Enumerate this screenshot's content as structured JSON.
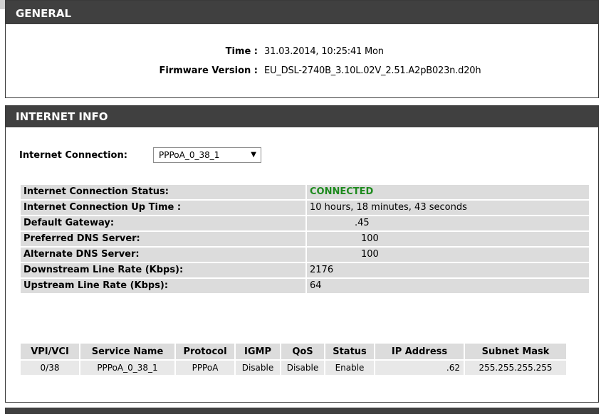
{
  "general": {
    "title": "GENERAL",
    "time_label": "Time :",
    "time_value": "31.03.2014, 10:25:41 Mon",
    "firmware_label": "Firmware Version :",
    "firmware_value": "EU_DSL-2740B_3.10L.02V_2.51.A2pB023n.d20h"
  },
  "internet_info": {
    "title": "INTERNET INFO",
    "connection_label": "Internet Connection:",
    "connection_selected": "PPPoA_0_38_1",
    "rows": [
      {
        "label": "Internet Connection Status:",
        "value": "CONNECTED"
      },
      {
        "label": "Internet Connection Up Time :",
        "value": "10 hours, 18 minutes, 43 seconds"
      },
      {
        "label": "Default Gateway:",
        "value": ".45"
      },
      {
        "label": "Preferred DNS Server:",
        "value": "100"
      },
      {
        "label": "Alternate DNS Server:",
        "value": "100"
      },
      {
        "label": "Downstream Line Rate (Kbps):",
        "value": "2176"
      },
      {
        "label": "Upstream Line Rate (Kbps):",
        "value": "64"
      }
    ],
    "table": {
      "headers": [
        "VPI/VCI",
        "Service Name",
        "Protocol",
        "IGMP",
        "QoS",
        "Status",
        "IP Address",
        "Subnet Mask"
      ],
      "row": [
        "0/38",
        "PPPoA_0_38_1",
        "PPPoA",
        "Disable",
        "Disable",
        "Enable",
        ".62",
        "255.255.255.255"
      ]
    }
  },
  "colors": {
    "header_bg": "#404040",
    "connected": "#1d8a1d"
  }
}
